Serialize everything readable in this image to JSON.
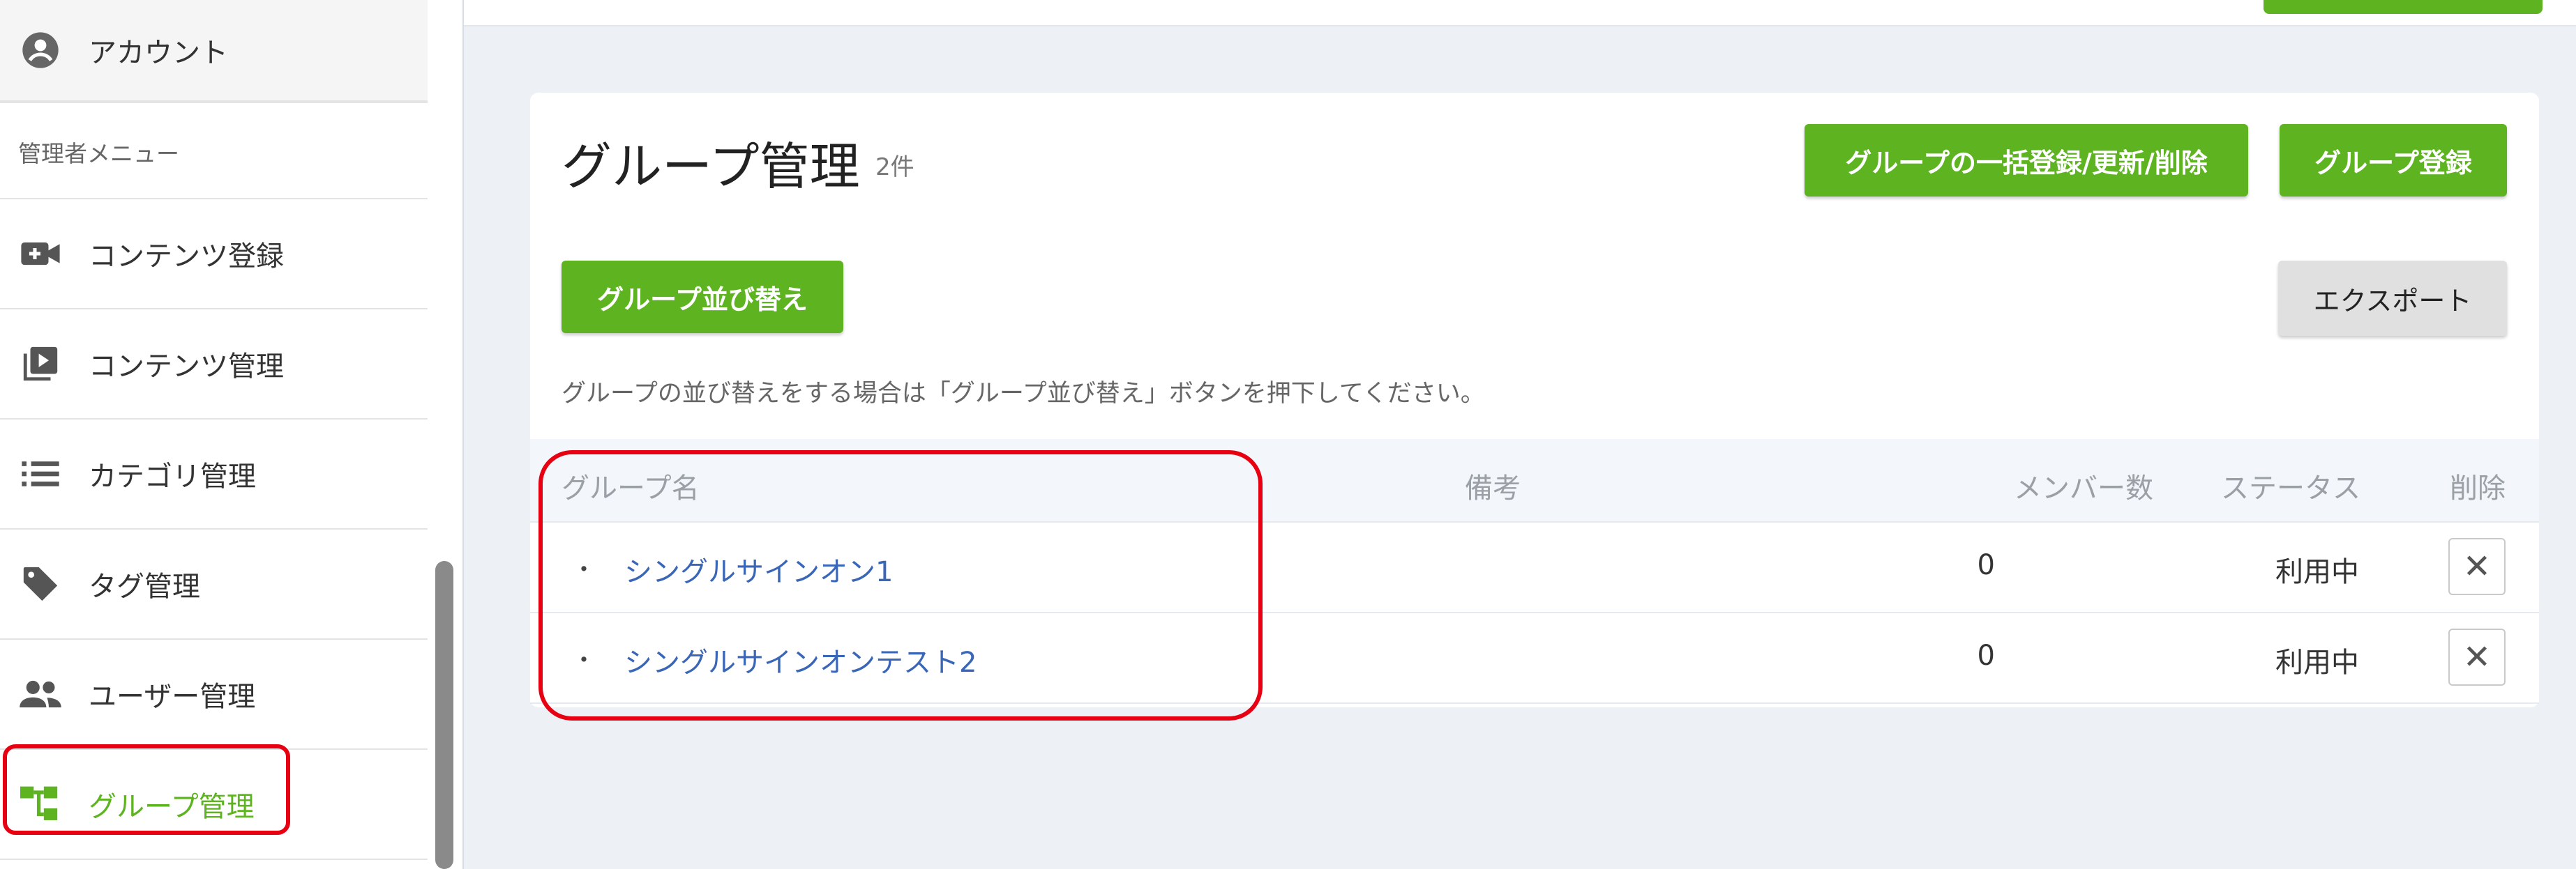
{
  "sidebar": {
    "account_label": "アカウント",
    "admin_header": "管理者メニュー",
    "items": [
      {
        "label": "コンテンツ登録",
        "icon": "video-add-icon"
      },
      {
        "label": "コンテンツ管理",
        "icon": "play-library-icon"
      },
      {
        "label": "カテゴリ管理",
        "icon": "list-icon"
      },
      {
        "label": "タグ管理",
        "icon": "tag-icon"
      },
      {
        "label": "ユーザー管理",
        "icon": "people-icon"
      },
      {
        "label": "グループ管理",
        "icon": "tree-icon",
        "active": true
      }
    ]
  },
  "main": {
    "title": "グループ管理",
    "count": "2件",
    "bulk_button": "グループの一括登録/更新/削除",
    "register_button": "グループ登録",
    "sort_button": "グループ並び替え",
    "export_button": "エクスポート",
    "hint": "グループの並び替えをする場合は「グループ並び替え」ボタンを押下してください。",
    "columns": [
      "グループ名",
      "備考",
      "メンバー数",
      "ステータス",
      "削除"
    ],
    "rows": [
      {
        "bullet": "・",
        "name": "シングルサインオン1",
        "note": "",
        "members": "0",
        "status": "利用中",
        "delete": "✕"
      },
      {
        "bullet": "・",
        "name": "シングルサインオンテスト2",
        "note": "",
        "members": "0",
        "status": "利用中",
        "delete": "✕"
      }
    ]
  },
  "colors": {
    "accent": "#5eb321",
    "highlight": "#e60012",
    "link": "#3a66b8"
  }
}
